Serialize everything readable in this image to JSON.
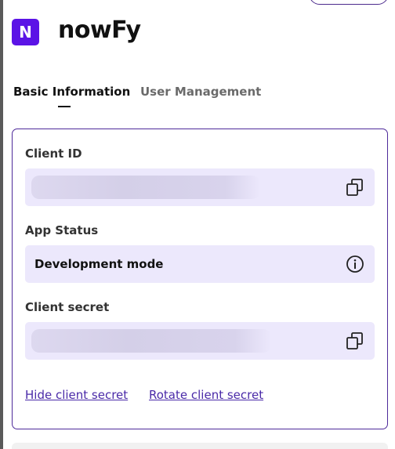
{
  "app": {
    "logo_letter": "N",
    "name": "nowFy"
  },
  "tabs": [
    {
      "label": "Basic Information",
      "active": true
    },
    {
      "label": "User Management",
      "active": false
    }
  ],
  "fields": {
    "client_id": {
      "label": "Client ID",
      "value_state": "blurred",
      "action_icon": "copy-icon"
    },
    "app_status": {
      "label": "App Status",
      "value": "Development mode",
      "action_icon": "info-icon"
    },
    "client_secret": {
      "label": "Client secret",
      "value_state": "blurred",
      "action_icon": "copy-icon"
    }
  },
  "links": {
    "hide_secret": "Hide client secret",
    "rotate_secret": "Rotate client secret"
  },
  "colors": {
    "brand": "#5b13e6",
    "card_border": "#4e2a9a",
    "field_bg": "#ece8fc",
    "link": "#4a2aa8"
  }
}
